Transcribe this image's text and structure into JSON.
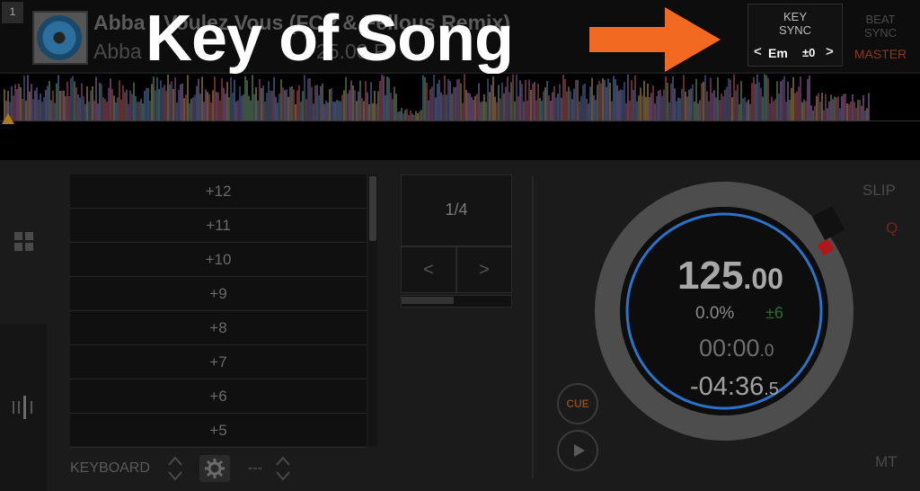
{
  "deck": {
    "number": "1"
  },
  "track": {
    "title": "Abba - Voulez Vous (FCP & Fellous Remix)",
    "artist": "Abba",
    "bpm_partial": "25.00 F"
  },
  "overlay": {
    "caption": "Key of Song"
  },
  "key_sync": {
    "label_line1": "KEY",
    "label_line2": "SYNC",
    "key": "Em",
    "offset": "±0",
    "prev_symbol": "<",
    "next_symbol": ">"
  },
  "beat_sync": {
    "label_line1": "BEAT",
    "label_line2": "SYNC",
    "master_label": "MASTER"
  },
  "key_shift_list": [
    "+12",
    "+11",
    "+10",
    "+9",
    "+8",
    "+7",
    "+6",
    "+5"
  ],
  "keyboard": {
    "label": "KEYBOARD",
    "value": "---"
  },
  "loop": {
    "value": "1/4",
    "prev": "<",
    "next": ">"
  },
  "deck_controls": {
    "slip": "SLIP",
    "quantize": "Q",
    "mt": "MT",
    "cue": "CUE"
  },
  "jog": {
    "bpm_int": "125",
    "bpm_dec": ".00",
    "pitch_percent": "0.0%",
    "pitch_range": "±6",
    "elapsed_main": "00:00",
    "elapsed_dec": ".0",
    "remaining_main": "-04:36",
    "remaining_dec": ".5"
  },
  "colors": {
    "accent_orange": "#f26a21",
    "ring_blue": "#2a73c9",
    "sync_green": "#2f6a30"
  }
}
